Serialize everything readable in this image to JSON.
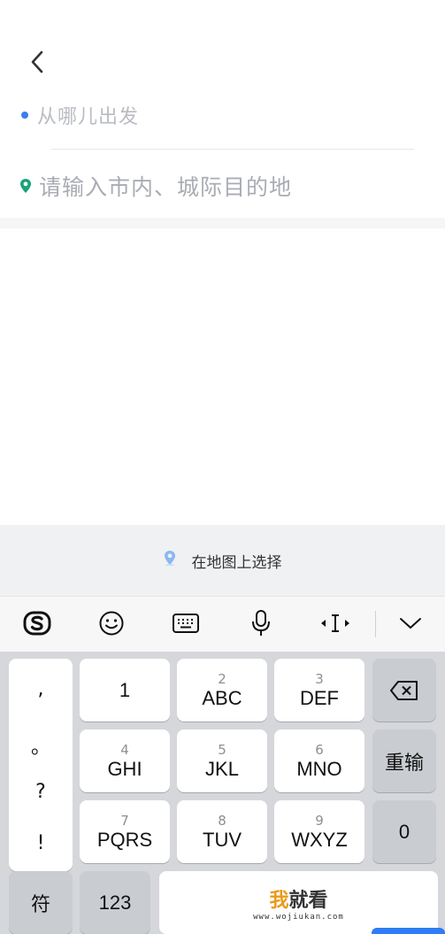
{
  "header": {
    "from_placeholder": "从哪儿出发",
    "to_placeholder": "请输入市内、城际目的地"
  },
  "map_select": {
    "label": "在地图上选择"
  },
  "toolbar": {
    "items": [
      "sogou-logo-icon",
      "emoji-icon",
      "keyboard-icon",
      "microphone-icon",
      "cursor-move-icon",
      "collapse-chevron-icon"
    ]
  },
  "keyboard": {
    "punctuation": [
      ",",
      "。",
      "?",
      "!"
    ],
    "keys": {
      "k1": {
        "num": "",
        "letters": "1"
      },
      "k2": {
        "num": "2",
        "letters": "ABC"
      },
      "k3": {
        "num": "3",
        "letters": "DEF"
      },
      "k4": {
        "num": "4",
        "letters": "GHI"
      },
      "k5": {
        "num": "5",
        "letters": "JKL"
      },
      "k6": {
        "num": "6",
        "letters": "MNO"
      },
      "k7": {
        "num": "7",
        "letters": "PQRS"
      },
      "k8": {
        "num": "8",
        "letters": "TUV"
      },
      "k9": {
        "num": "9",
        "letters": "WXYZ"
      }
    },
    "retype_label": "重输",
    "zero_label": "0",
    "symbols_label": "符",
    "numbers_label": "123"
  },
  "watermark": {
    "main_prefix": "我",
    "main_rest": "就看",
    "sub": "www.wojiukan.com"
  },
  "colors": {
    "accent_blue": "#3a7ef0",
    "pin_green": "#1aa37a",
    "watermark_orange": "#e99a1c"
  }
}
